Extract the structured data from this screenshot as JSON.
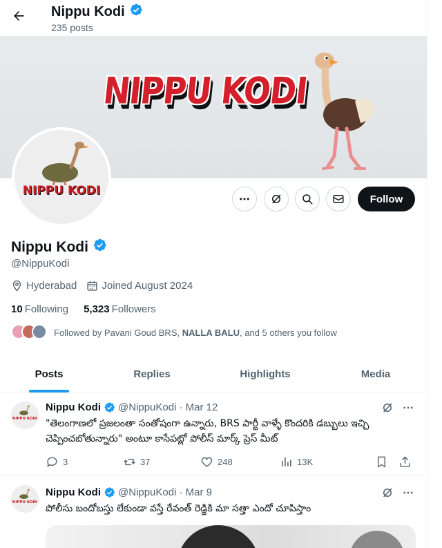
{
  "header": {
    "name": "Nippu Kodi",
    "posts_count": "235 posts"
  },
  "banner": {
    "title": "NIPPU KODI"
  },
  "avatar": {
    "text": "NIPPU KODI"
  },
  "actions": {
    "follow_label": "Follow"
  },
  "profile": {
    "name": "Nippu Kodi",
    "handle": "@NippuKodi",
    "location": "Hyderabad",
    "joined": "Joined August 2024",
    "following_count": "10",
    "following_label": "Following",
    "followers_count": "5,323",
    "followers_label": "Followers",
    "followed_by_prefix": "Followed by Pavani Goud BRS, ",
    "followed_by_bold": "NALLA BALU",
    "followed_by_suffix": ", and 5 others you follow"
  },
  "tabs": [
    "Posts",
    "Replies",
    "Highlights",
    "Media"
  ],
  "posts": [
    {
      "name": "Nippu Kodi",
      "handle": "@NippuKodi",
      "date": "· Mar 12",
      "avatar_text": "NIPPU KODI",
      "text": "\"తెలంగాణలో ప్రజలంతా సంతోషంగా ఉన్నారు, BRS పార్టీ వాళ్ళే కొందరికి డబ్బులు ఇచ్చి చెప్పించబోతున్నారు\" అంటూ కాసేపట్లో పోలీస్ మార్క్ ప్రెస్ మీట్",
      "replies": "3",
      "reposts": "37",
      "likes": "248",
      "views": "13K"
    },
    {
      "name": "Nippu Kodi",
      "handle": "@NippuKodi",
      "date": "· Mar 9",
      "avatar_text": "NIPPU KODI",
      "text": "పోలీసు బందోబస్తు లేకుండా వస్తే రేవంత్ రెడ్డికి మా సత్తా ఎందో చూపిస్తాం"
    }
  ],
  "colors": {
    "accent": "#1d9bf0",
    "text": "#0f1419",
    "muted": "#536471",
    "banner_red": "#d4202a"
  }
}
